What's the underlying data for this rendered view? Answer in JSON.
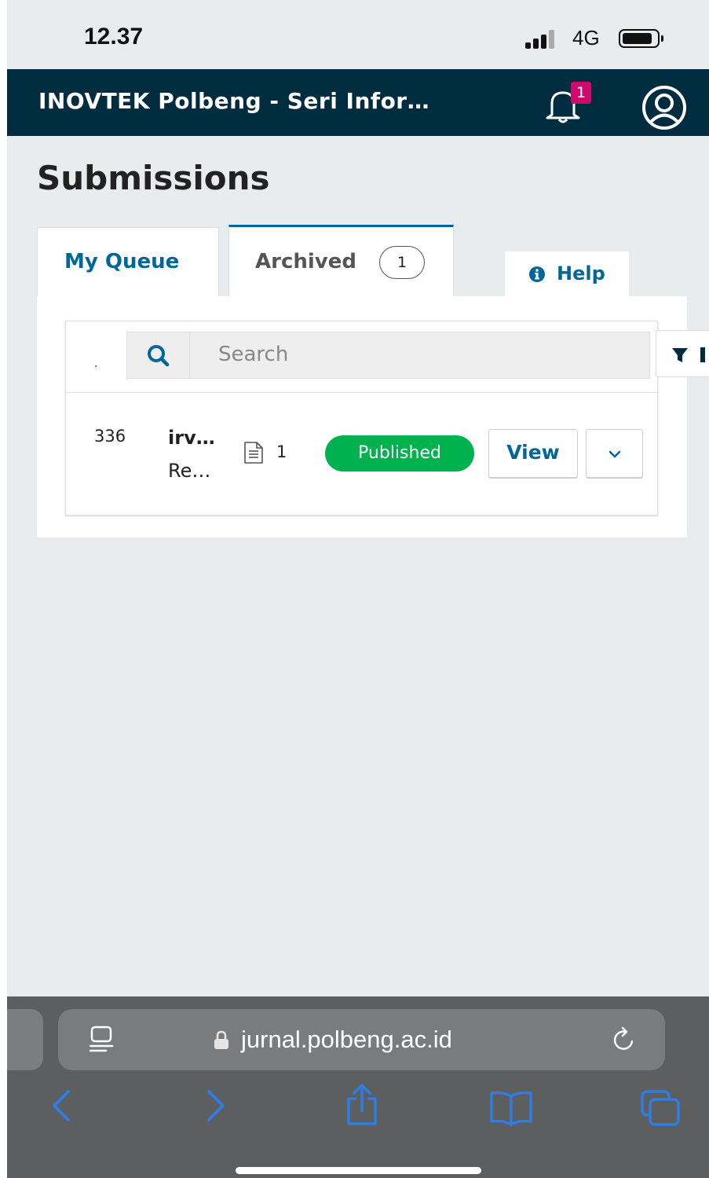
{
  "status_bar": {
    "time": "12.37",
    "network": "4G"
  },
  "app_header": {
    "title": "INOVTEK Polbeng - Seri Infor…",
    "notification_count": "1"
  },
  "page": {
    "title": "Submissions"
  },
  "tabs": [
    {
      "label": "My Queue",
      "active": false
    },
    {
      "label": "Archived",
      "count": "1",
      "active": true
    }
  ],
  "help": {
    "label": "Help"
  },
  "search": {
    "placeholder": "Search",
    "leading_mark": "."
  },
  "submission": {
    "id": "336",
    "author": "irv…",
    "title": "Re…",
    "file_count": "1",
    "status": "Published",
    "view_label": "View"
  },
  "browser": {
    "url": "jurnal.polbeng.ac.id"
  },
  "colors": {
    "header_bg": "#002c3f",
    "accent": "#006798",
    "published": "#00b24e",
    "notification_badge": "#d00a6c",
    "safari_blue": "#2f7de1"
  }
}
